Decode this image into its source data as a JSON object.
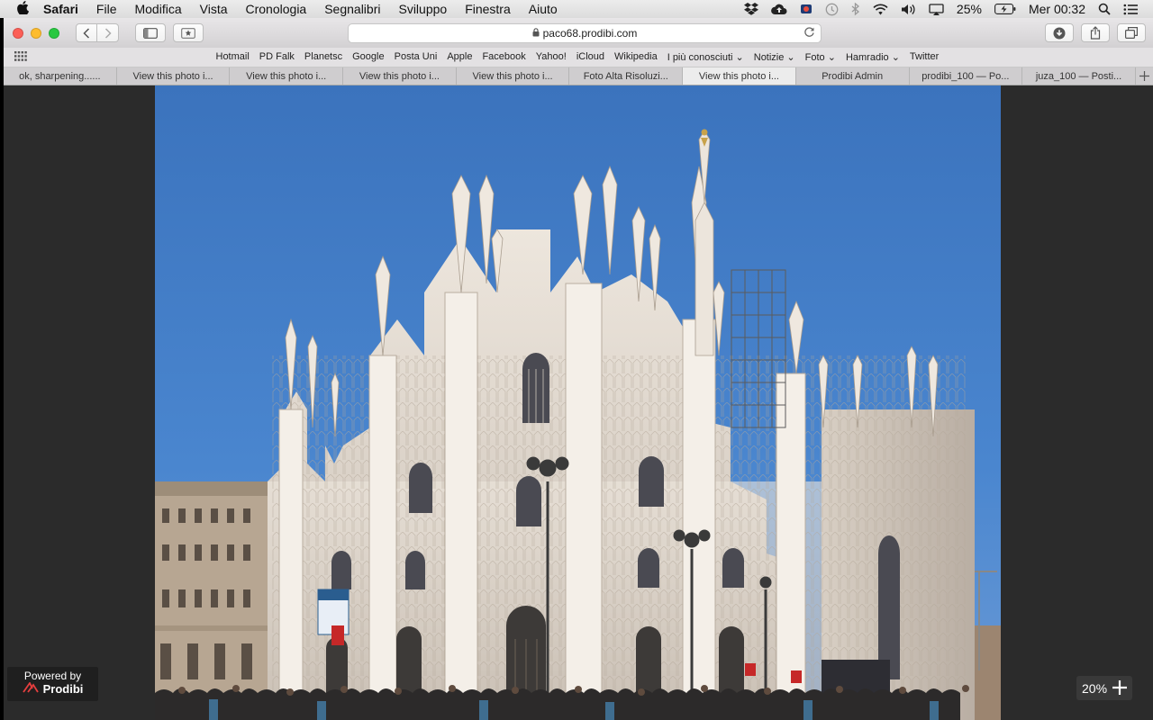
{
  "menubar": {
    "app": "Safari",
    "items": [
      "File",
      "Modifica",
      "Vista",
      "Cronologia",
      "Segnalibri",
      "Sviluppo",
      "Finestra",
      "Aiuto"
    ],
    "battery": "25%",
    "clock": "Mer 00:32"
  },
  "address": {
    "url": "paco68.prodibi.com"
  },
  "bookmarks": [
    "Hotmail",
    "PD Falk",
    "Planetsc",
    "Google",
    "Posta Uni",
    "Apple",
    "Facebook",
    "Yahoo!",
    "iCloud",
    "Wikipedia",
    "I più conosciuti ⌄",
    "Notizie ⌄",
    "Foto ⌄",
    "Hamradio ⌄",
    "Twitter"
  ],
  "tabs": [
    {
      "label": "ok, sharpening......",
      "active": false
    },
    {
      "label": "View this photo i...",
      "active": false
    },
    {
      "label": "View this photo i...",
      "active": false
    },
    {
      "label": "View this photo i...",
      "active": false
    },
    {
      "label": "View this photo i...",
      "active": false
    },
    {
      "label": "Foto Alta Risoluzi...",
      "active": false
    },
    {
      "label": "View this photo i...",
      "active": true
    },
    {
      "label": "Prodibi Admin",
      "active": false
    },
    {
      "label": "prodibi_100 — Po...",
      "active": false
    },
    {
      "label": "juza_100 — Posti...",
      "active": false
    }
  ],
  "overlay": {
    "powered_by": "Powered by",
    "brand": "Prodibi",
    "zoom": "20%"
  },
  "colors": {
    "sky": "#3f78c2",
    "marble": "#d9d1c8",
    "viewer_bg": "#2b2b2b"
  }
}
